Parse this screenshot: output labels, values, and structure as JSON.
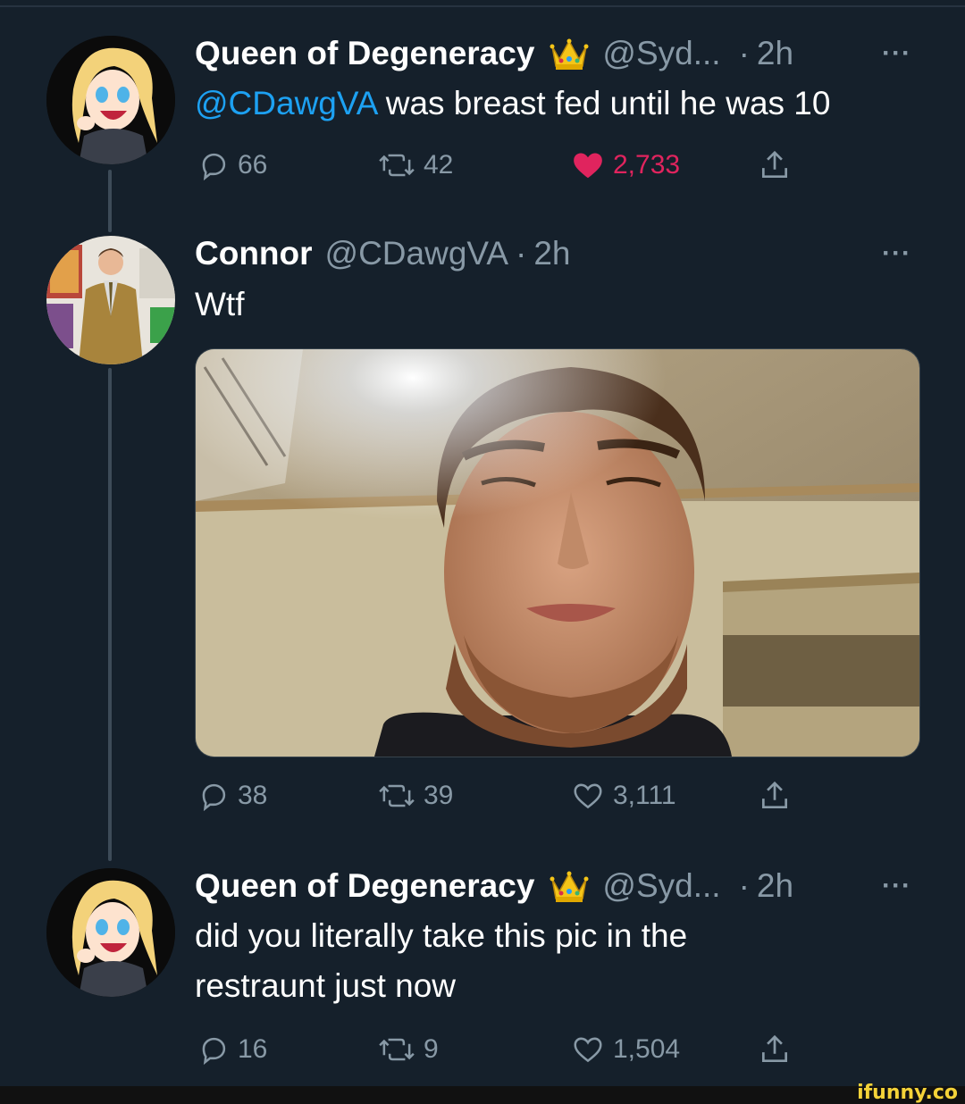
{
  "tweets": [
    {
      "display_name": "Queen of Degeneracy",
      "badge_icon": "crown-icon",
      "handle": "@Syd...",
      "separator": "·",
      "time": "2h",
      "more": "···",
      "mention": "@CDawgVA",
      "text": " was breast fed until he was 10",
      "replies": "66",
      "retweets": "42",
      "likes": "2,733",
      "liked": true
    },
    {
      "display_name": "Connor",
      "handle": "@CDawgVA",
      "separator": "·",
      "time": "2h",
      "more": "···",
      "text": "Wtf",
      "replies": "38",
      "retweets": "39",
      "likes": "3,111",
      "liked": false
    },
    {
      "display_name": "Queen of Degeneracy",
      "badge_icon": "crown-icon",
      "handle": "@Syd...",
      "separator": "·",
      "time": "2h",
      "more": "···",
      "text": "did you literally take this pic in the restraunt just now",
      "replies": "16",
      "retweets": "9",
      "likes": "1,504",
      "liked": false
    }
  ],
  "watermark": "ifunny.co",
  "colors": {
    "background": "#15202b",
    "text_primary": "#ffffff",
    "text_secondary": "#8899a6",
    "link": "#1da1f2",
    "like": "#e0245e",
    "thread_line": "#3d4b58"
  }
}
